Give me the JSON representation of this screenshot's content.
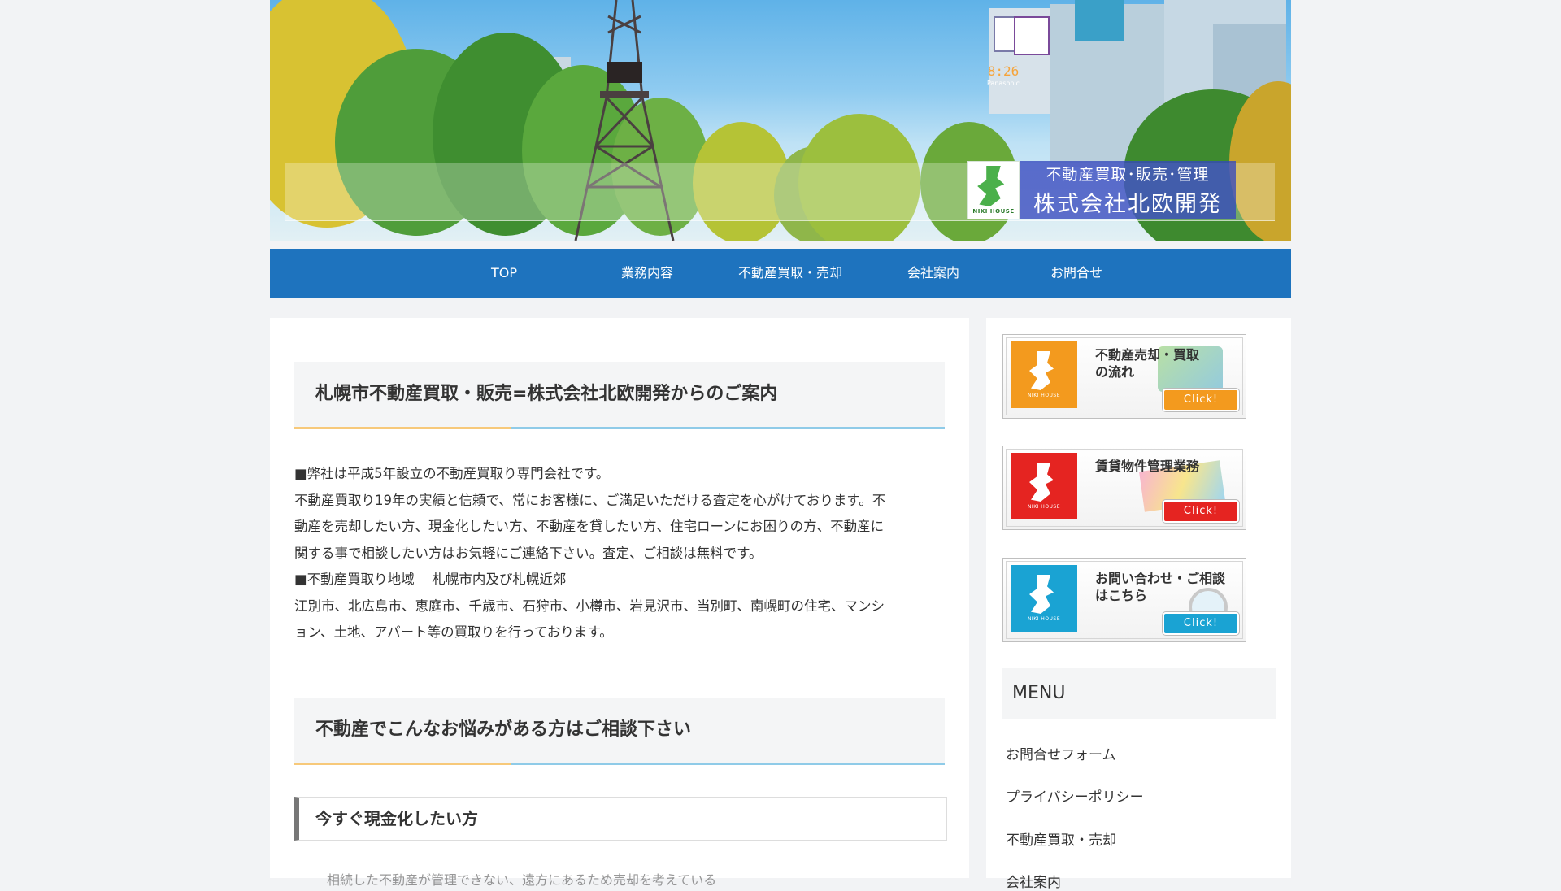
{
  "header": {
    "brand_sub": "不動産買取･販売･管理",
    "brand_name": "株式会社北欧開発",
    "logo_text": "NIKI HOUSE",
    "tower_clock": "8:26",
    "tower_label": "Panasonic"
  },
  "nav": {
    "items": [
      "TOP",
      "業務内容",
      "不動産買取・売却",
      "会社案内",
      "お問合せ"
    ]
  },
  "main": {
    "heading1": "札幌市不動産買取・販売=株式会社北欧開発からのご案内",
    "intro_lines": [
      "■弊社は平成5年設立の不動産買取り専門会社です。",
      "不動産買取り19年の実績と信頼で、常にお客様に、ご満足いただける査定を心がけております。不",
      "動産を売却したい方、現金化したい方、不動産を貸したい方、住宅ローンにお困りの方、不動産に",
      "関する事で相談したい方はお気軽にご連絡下さい。査定、ご相談は無料です。"
    ],
    "area_lines": [
      "■不動産買取り地域　 札幌市内及び札幌近郊",
      "江別市、北広島市、恵庭市、千歳市、石狩市、小樽市、岩見沢市、当別町、南幌町の住宅、マンシ",
      "ョン、土地、アパート等の買取りを行っております。"
    ],
    "heading2": "不動産でこんなお悩みがある方はご相談下さい",
    "heading3": "今すぐ現金化したい方",
    "faded_line": "相続した不動産が管理できない、遠方にあるため売却を考えている"
  },
  "sidebar": {
    "banners": [
      {
        "title_line1": "不動産売却・買取",
        "title_line2": "の流れ",
        "button": "Click!",
        "color": "#f39a1e"
      },
      {
        "title_line1": "賃貸物件管理業務",
        "title_line2": "",
        "button": "Click!",
        "color": "#e52421"
      },
      {
        "title_line1": "お問い合わせ・ご相談",
        "title_line2": "はこちら",
        "button": "Click!",
        "color": "#1aa3d3"
      }
    ],
    "logo_text": "NIKI HOUSE",
    "menu_title": "MENU",
    "menu_items": [
      "お問合せフォーム",
      "プライバシーポリシー",
      "不動産買取・売却",
      "会社案内"
    ]
  },
  "colors": {
    "nav_bg": "#1e73be",
    "page_bg": "#f2f3f5",
    "heading_bg": "#f4f5f6",
    "accent_blue": "#8fcbe8",
    "accent_orange": "#f7c97a"
  }
}
